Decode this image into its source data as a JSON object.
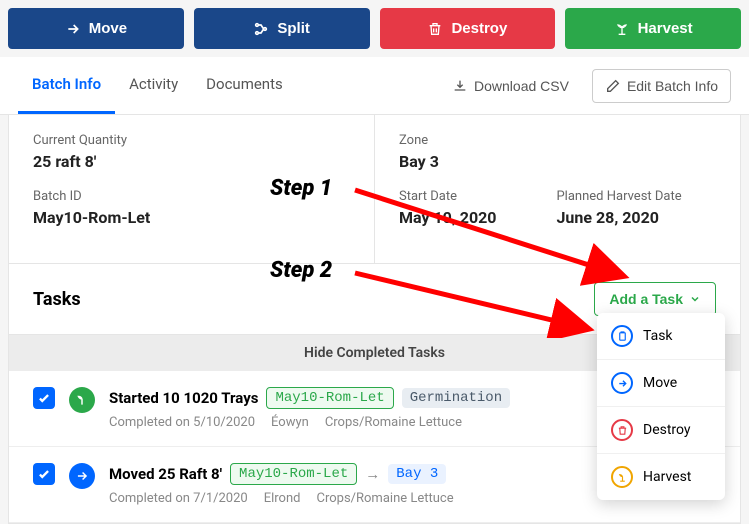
{
  "topButtons": {
    "move": "Move",
    "split": "Split",
    "destroy": "Destroy",
    "harvest": "Harvest"
  },
  "tabs": {
    "batchInfo": "Batch Info",
    "activity": "Activity",
    "documents": "Documents"
  },
  "tabActions": {
    "downloadCsv": "Download CSV",
    "editBatchInfo": "Edit Batch Info"
  },
  "info": {
    "currentQtyLabel": "Current Quantity",
    "currentQtyValue": "25 raft 8'",
    "batchIdLabel": "Batch ID",
    "batchIdValue": "May10-Rom-Let",
    "zoneLabel": "Zone",
    "zoneValue": "Bay 3",
    "startDateLabel": "Start Date",
    "startDateValue": "May 10, 2020",
    "harvestDateLabel": "Planned Harvest Date",
    "harvestDateValue": "June 28, 2020"
  },
  "tasks": {
    "title": "Tasks",
    "addLabel": "Add a Task",
    "hideLabel": "Hide Completed Tasks",
    "rows": [
      {
        "title": "Started 10 1020 Trays",
        "batchTag": "May10-Rom-Let",
        "stageTag": "Germination",
        "completed": "Completed on 5/10/2020",
        "user": "Éowyn",
        "crop": "Crops/Romaine Lettuce"
      },
      {
        "title": "Moved 25 Raft 8'",
        "batchTag": "May10-Rom-Let",
        "destTag": "Bay 3",
        "completed": "Completed on 7/1/2020",
        "user": "Elrond",
        "crop": "Crops/Romaine Lettuce"
      }
    ]
  },
  "dropdown": {
    "task": "Task",
    "move": "Move",
    "destroy": "Destroy",
    "harvest": "Harvest"
  },
  "annotations": {
    "step1": "Step 1",
    "step2": "Step 2"
  }
}
